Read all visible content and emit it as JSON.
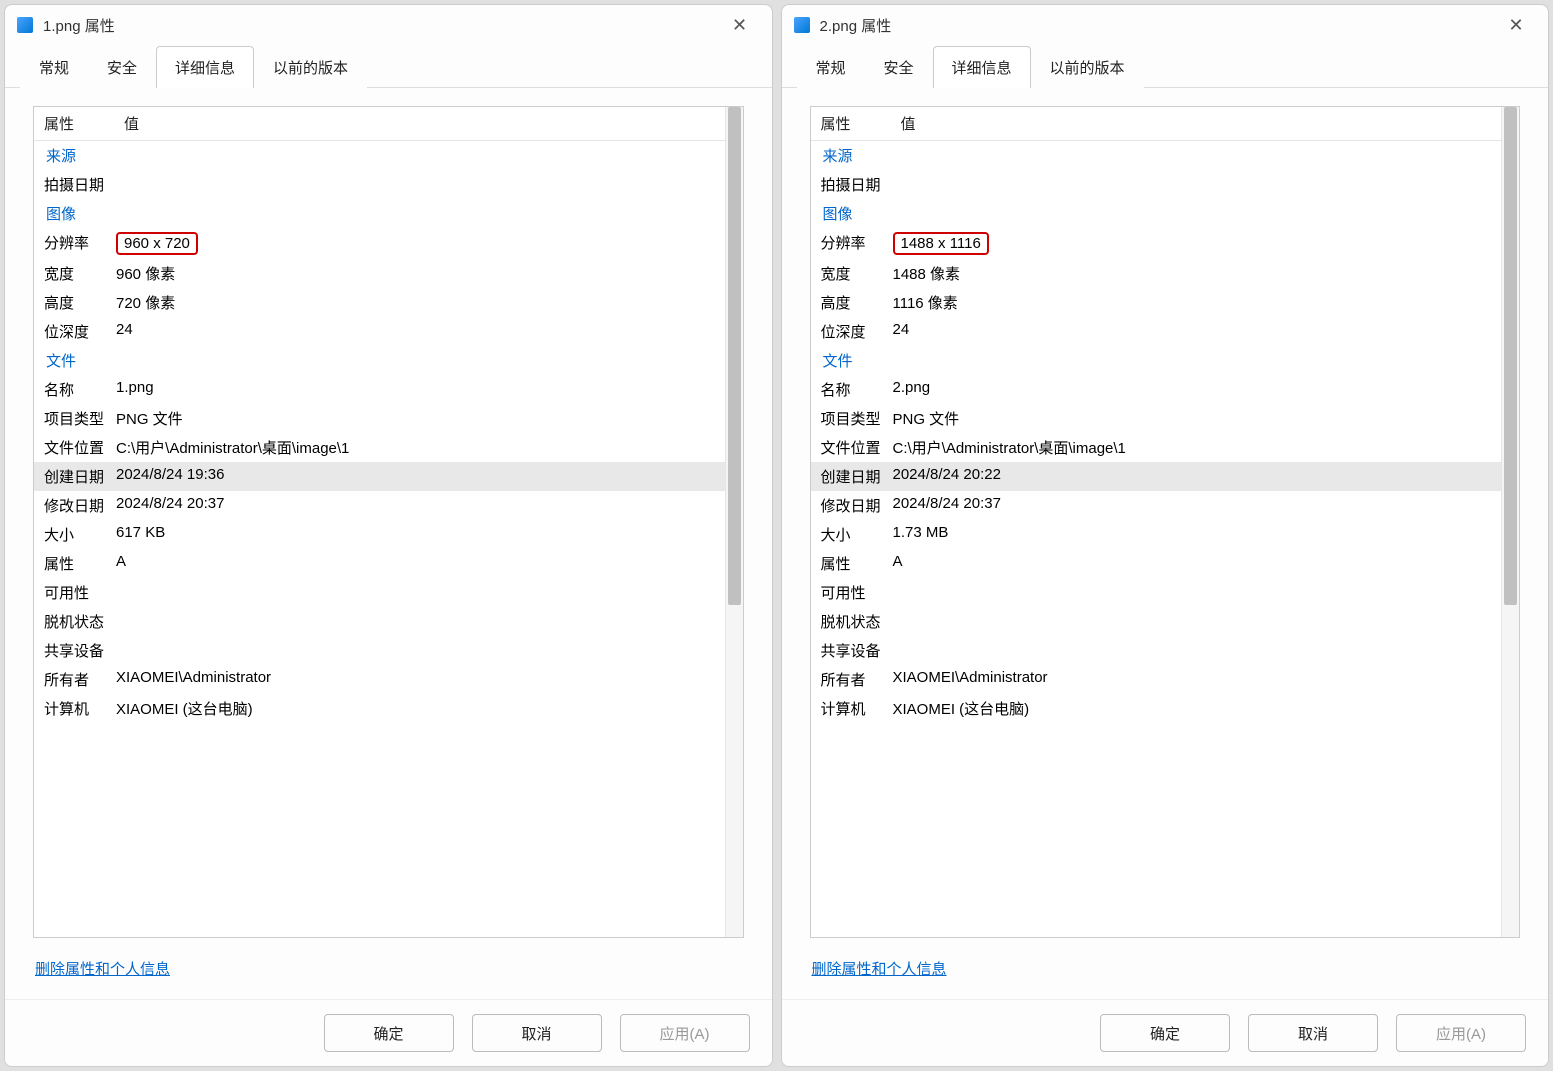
{
  "windows": [
    {
      "title": "1.png 属性",
      "tabs": [
        "常规",
        "安全",
        "详细信息",
        "以前的版本"
      ],
      "activeTab": 2,
      "header_prop": "属性",
      "header_val": "值",
      "sections": [
        {
          "label": "来源",
          "rows": [
            {
              "name": "拍摄日期",
              "value": ""
            }
          ]
        },
        {
          "label": "图像",
          "rows": [
            {
              "name": "分辨率",
              "value": "960 x 720",
              "boxed": true
            },
            {
              "name": "宽度",
              "value": "960 像素"
            },
            {
              "name": "高度",
              "value": "720 像素"
            },
            {
              "name": "位深度",
              "value": "24"
            }
          ]
        },
        {
          "label": "文件",
          "rows": [
            {
              "name": "名称",
              "value": "1.png"
            },
            {
              "name": "项目类型",
              "value": "PNG 文件"
            },
            {
              "name": "文件位置",
              "value": "C:\\用户\\Administrator\\桌面\\image\\1"
            },
            {
              "name": "创建日期",
              "value": "2024/8/24 19:36",
              "hl": true
            },
            {
              "name": "修改日期",
              "value": "2024/8/24 20:37"
            },
            {
              "name": "大小",
              "value": "617 KB"
            },
            {
              "name": "属性",
              "value": "A"
            },
            {
              "name": "可用性",
              "value": ""
            },
            {
              "name": "脱机状态",
              "value": ""
            },
            {
              "name": "共享设备",
              "value": ""
            },
            {
              "name": "所有者",
              "value": "XIAOMEI\\Administrator"
            },
            {
              "name": "计算机",
              "value": "XIAOMEI (这台电脑)"
            }
          ]
        }
      ],
      "remove_link": "删除属性和个人信息",
      "buttons": {
        "ok": "确定",
        "cancel": "取消",
        "apply": "应用(A)"
      }
    },
    {
      "title": "2.png 属性",
      "tabs": [
        "常规",
        "安全",
        "详细信息",
        "以前的版本"
      ],
      "activeTab": 2,
      "header_prop": "属性",
      "header_val": "值",
      "sections": [
        {
          "label": "来源",
          "rows": [
            {
              "name": "拍摄日期",
              "value": ""
            }
          ]
        },
        {
          "label": "图像",
          "rows": [
            {
              "name": "分辨率",
              "value": "1488 x 1116",
              "boxed": true
            },
            {
              "name": "宽度",
              "value": "1488 像素"
            },
            {
              "name": "高度",
              "value": "1116 像素"
            },
            {
              "name": "位深度",
              "value": "24"
            }
          ]
        },
        {
          "label": "文件",
          "rows": [
            {
              "name": "名称",
              "value": "2.png"
            },
            {
              "name": "项目类型",
              "value": "PNG 文件"
            },
            {
              "name": "文件位置",
              "value": "C:\\用户\\Administrator\\桌面\\image\\1"
            },
            {
              "name": "创建日期",
              "value": "2024/8/24 20:22",
              "hl": true
            },
            {
              "name": "修改日期",
              "value": "2024/8/24 20:37"
            },
            {
              "name": "大小",
              "value": "1.73 MB"
            },
            {
              "name": "属性",
              "value": "A"
            },
            {
              "name": "可用性",
              "value": ""
            },
            {
              "name": "脱机状态",
              "value": ""
            },
            {
              "name": "共享设备",
              "value": ""
            },
            {
              "name": "所有者",
              "value": "XIAOMEI\\Administrator"
            },
            {
              "name": "计算机",
              "value": "XIAOMEI (这台电脑)"
            }
          ]
        }
      ],
      "remove_link": "删除属性和个人信息",
      "buttons": {
        "ok": "确定",
        "cancel": "取消",
        "apply": "应用(A)"
      }
    }
  ]
}
